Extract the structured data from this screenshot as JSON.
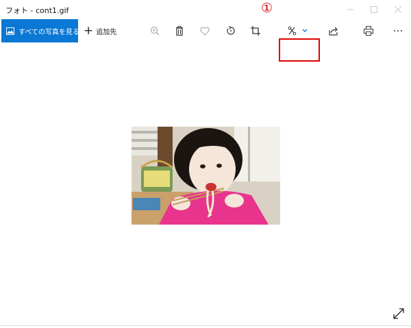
{
  "window": {
    "title": "フォト - cont1.gif",
    "controls": [
      "minimize-icon",
      "maximize-icon",
      "close-icon"
    ]
  },
  "annotation": {
    "marker": "①",
    "color": "#d40000"
  },
  "toolbar": {
    "view_all_label": "すべての写真を見る",
    "add_label": "追加先",
    "icons": [
      "zoom-icon",
      "delete-icon",
      "favorite-icon",
      "rotate-icon",
      "crop-icon",
      "edit-icon",
      "share-icon",
      "print-icon",
      "more-icon"
    ],
    "accent_color": "#0a78d4",
    "highlight_color": "#e00000"
  },
  "viewer": {
    "image_name": "cont1.gif",
    "image_subject": "child eating noodles",
    "expand_icon": "expand-icon"
  }
}
